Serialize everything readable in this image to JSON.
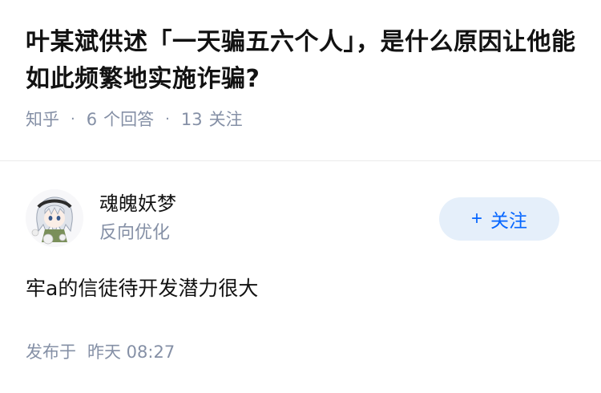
{
  "question": {
    "title": "叶某斌供述「一天骗五六个人」，是什么原因让他能如此频繁地实施诈骗?",
    "source": "知乎",
    "answer_count": "6",
    "answer_label": "个回答",
    "follower_count": "13",
    "follower_label": "关注"
  },
  "answer": {
    "author": {
      "name": "魂魄妖梦",
      "headline": "反向优化",
      "avatar_icon": "anime-avatar-icon"
    },
    "follow_button": {
      "plus": "+",
      "label": "关注"
    },
    "content": "牢a的信徒待开发潜力很大",
    "time_label": "发布于",
    "time_value": "昨天 08:27"
  },
  "colors": {
    "title": "#121212",
    "meta": "#8590a6",
    "follow_bg": "#e5effa",
    "follow_text": "#0566ff",
    "divider": "#ebebeb"
  }
}
